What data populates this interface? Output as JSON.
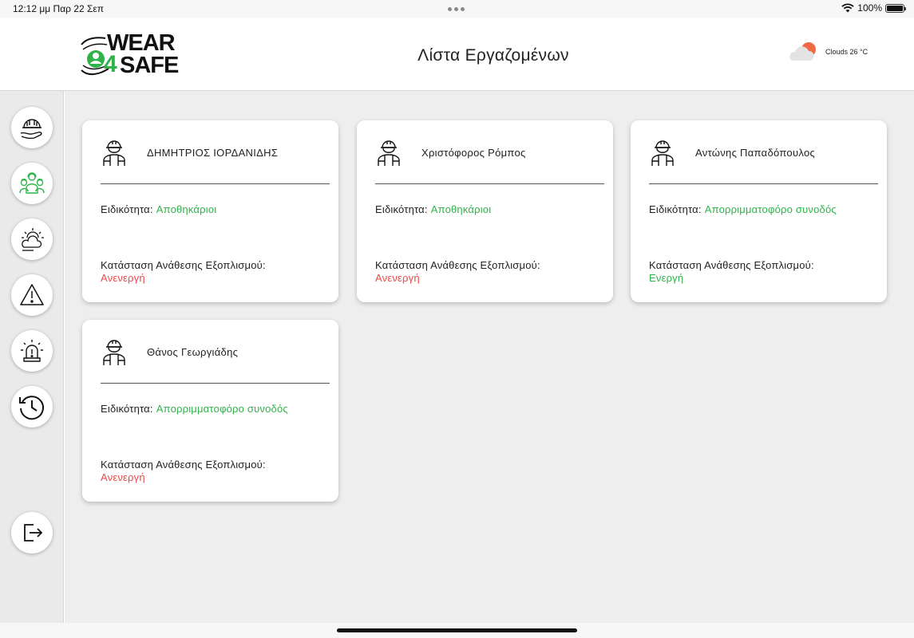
{
  "status_bar": {
    "time": "12:12 μμ   Παρ 22 Σεπ",
    "battery": "100%"
  },
  "header": {
    "logo_text_top": "WEAR",
    "logo_text_four": "4",
    "logo_text_bottom": "SAFE",
    "title": "Λίστα Εργαζομένων",
    "weather": {
      "text": "Clouds 26 °C",
      "icon": "partly-cloudy-icon"
    }
  },
  "sidebar": {
    "items": [
      {
        "icon": "hardhat-hand-icon"
      },
      {
        "icon": "workers-group-icon"
      },
      {
        "icon": "weather-icon"
      },
      {
        "icon": "warning-icon"
      },
      {
        "icon": "alarm-icon"
      },
      {
        "icon": "history-icon"
      },
      {
        "icon": "logout-icon"
      }
    ]
  },
  "labels": {
    "specialty": "Ειδικότητα:",
    "status": "Κατάσταση Ανάθεσης Εξοπλισμού:"
  },
  "employees": [
    {
      "name": "ΔΗΜΗΤΡΙΟΣ ΙΟΡΔΑΝΙΔΗΣ",
      "specialty": "Αποθηκάριοι",
      "status": "Ανενεργή",
      "status_color": "#f04848"
    },
    {
      "name": "Χριστόφορος Ρόμπος",
      "specialty": "Αποθηκάριοι",
      "status": "Ανενεργή",
      "status_color": "#f04848"
    },
    {
      "name": "Αντώνης Παπαδόπουλος",
      "specialty": "Απορριμματοφόρο συνοδός",
      "status": "Ενεργή",
      "status_color": "#2fb34a"
    },
    {
      "name": "Θάνος Γεωργιάδης",
      "specialty": "Απορριμματοφόρο συνοδός",
      "status": "Ανενεργή",
      "status_color": "#f04848"
    }
  ],
  "colors": {
    "accent_green": "#2fb34a",
    "inactive_red": "#f04848",
    "sidebar_bg": "#eaeaea",
    "content_bg": "#eeeeef"
  }
}
